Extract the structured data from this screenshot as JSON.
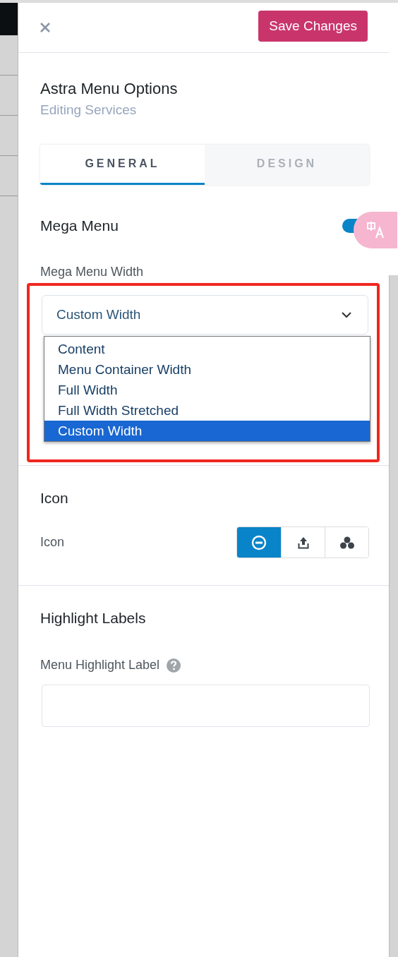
{
  "header": {
    "save_button": "Save Changes"
  },
  "title": "Astra Menu Options",
  "subtitle": "Editing Services",
  "tabs": [
    {
      "label": "GENERAL",
      "selected": true
    },
    {
      "label": "DESIGN",
      "selected": false
    }
  ],
  "mega_menu": {
    "heading": "Mega Menu",
    "toggle_on": true,
    "width_label": "Mega Menu Width",
    "select_value": "Custom Width",
    "options": [
      {
        "label": "Content",
        "selected": false
      },
      {
        "label": "Menu Container Width",
        "selected": false
      },
      {
        "label": "Full Width",
        "selected": false
      },
      {
        "label": "Full Width Stretched",
        "selected": false
      },
      {
        "label": "Custom Width",
        "selected": true
      }
    ]
  },
  "icon_section": {
    "heading": "Icon",
    "label": "Icon",
    "choices": [
      {
        "kind": "none",
        "selected": true
      },
      {
        "kind": "upload",
        "selected": false
      },
      {
        "kind": "dashicons",
        "selected": false
      }
    ]
  },
  "highlight": {
    "heading": "Highlight Labels",
    "label": "Menu Highlight Label"
  }
}
